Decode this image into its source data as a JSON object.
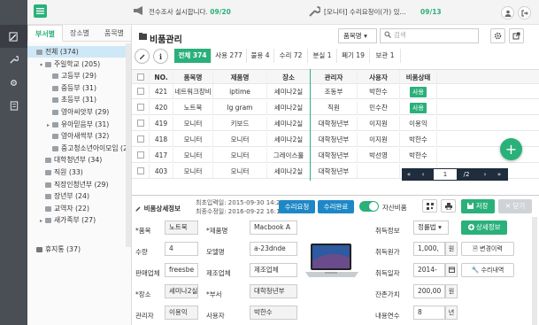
{
  "topbar": {
    "notice1": {
      "text": "전수조사 실시합니다.",
      "count": "09/20"
    },
    "notice2": {
      "text": "[모니터] 수리요청이(가) 있...",
      "count": "09/13"
    }
  },
  "sidebar": {
    "tabs": [
      "부서별",
      "장소별",
      "품목별"
    ],
    "tree": [
      {
        "label": "전체 (374)",
        "level": 0,
        "selected": true
      },
      {
        "label": "주일학교 (205)",
        "level": 1,
        "toggle": "▾"
      },
      {
        "label": "고등부 (29)",
        "level": 2
      },
      {
        "label": "중등부 (31)",
        "level": 2
      },
      {
        "label": "초등부 (31)",
        "level": 2
      },
      {
        "label": "영아씨앗부 (29)",
        "level": 2
      },
      {
        "label": "유아믿음부 (31)",
        "level": 2,
        "toggle": "▸"
      },
      {
        "label": "영아새싹부 (32)",
        "level": 2
      },
      {
        "label": "중고청소년아이모임 (2",
        "level": 2
      },
      {
        "label": "대학청년부 (34)",
        "level": 1
      },
      {
        "label": "직원 (33)",
        "level": 1
      },
      {
        "label": "직장인청년부 (29)",
        "level": 1
      },
      {
        "label": "장년부 (24)",
        "level": 1
      },
      {
        "label": "교역자 (22)",
        "level": 1
      },
      {
        "label": "새가족부 (27)",
        "level": 1,
        "toggle": "▸"
      },
      {
        "label": "휴지통 (37)",
        "level": 0,
        "trash": true
      }
    ]
  },
  "main": {
    "title": "비품관리",
    "dropdown": "품목명 ▾",
    "search_placeholder": "검색",
    "stats": [
      "전체 374",
      "사용 277",
      "불용 4",
      "수리 72",
      "분실 1",
      "폐기 19",
      "보관 1"
    ],
    "columns": [
      "",
      "NO.",
      "품목명",
      "제품명",
      "장소",
      "관리자",
      "사용자",
      "비품상태"
    ],
    "rows": [
      {
        "no": "421",
        "item": "네트워크장비",
        "product": "iptime",
        "place": "세미나2실",
        "manager": "조동부",
        "user": "박한수",
        "status": "사용"
      },
      {
        "no": "420",
        "item": "노트북",
        "product": "lg gram",
        "place": "세미나2실",
        "manager": "직원",
        "user": "민수찬",
        "status": "사용"
      },
      {
        "no": "419",
        "item": "모니터",
        "product": "키보드",
        "place": "세미나2실",
        "manager": "대학청년부",
        "user": "이지원",
        "status": "이용익"
      },
      {
        "no": "418",
        "item": "모니터",
        "product": "모니터",
        "place": "세미나2실",
        "manager": "대학청년부",
        "user": "이지원",
        "status": "박한수"
      },
      {
        "no": "417",
        "item": "모니터",
        "product": "모니터",
        "place": "그레이스홀",
        "manager": "대학청년부",
        "user": "박선영",
        "status": "박한수"
      },
      {
        "no": "403",
        "item": "모니터",
        "product": "모니터",
        "place": "세미나2실",
        "manager": "대학청년부",
        "user": "",
        "status": ""
      }
    ],
    "pager": {
      "first": "«",
      "prev": "‹",
      "page": "1",
      "total": "/2",
      "next": "›",
      "last": "»"
    }
  },
  "detail": {
    "title": "비품상세정보",
    "first_input": "최초입력일: 2015-09-30 14:29:25",
    "last_edit": "최종수정일: 2016-09-22 16:12:54",
    "repair_request": "수리요청",
    "repair_done": "수리완료",
    "toggle_label": "자산비품",
    "save": "저장",
    "close": "닫기",
    "fields": {
      "item_label": "*품목",
      "item": "노트북",
      "product_label": "*제품명",
      "product": "Macbook A",
      "qty_label": "수량",
      "qty": "4",
      "model_label": "모델명",
      "model": "a-23dnde",
      "seller_label": "판매업체",
      "seller": "freesbe",
      "maker_label": "제조업체",
      "maker": "제조업체",
      "place_label": "*장소",
      "place": "세미나2실",
      "dept_label": "*부서",
      "dept": "대학청년부",
      "manager_label": "관리자",
      "manager": "이용익",
      "user_label": "사용자",
      "user": "박한수",
      "acq_label": "취득정보",
      "acq": "정률법 ▾",
      "acq_cost_label": "취득원가",
      "acq_cost": "1,000,",
      "acq_date_label": "취득일자",
      "acq_date": "2014-",
      "residual_label": "잔존가치",
      "residual": "200,00",
      "years_label": "내용연수",
      "years": "8",
      "won": "원",
      "year_unit": "년"
    },
    "detail_btn": "상세정보",
    "history_btn": "변경이력",
    "repair_btn": "수리내역"
  }
}
